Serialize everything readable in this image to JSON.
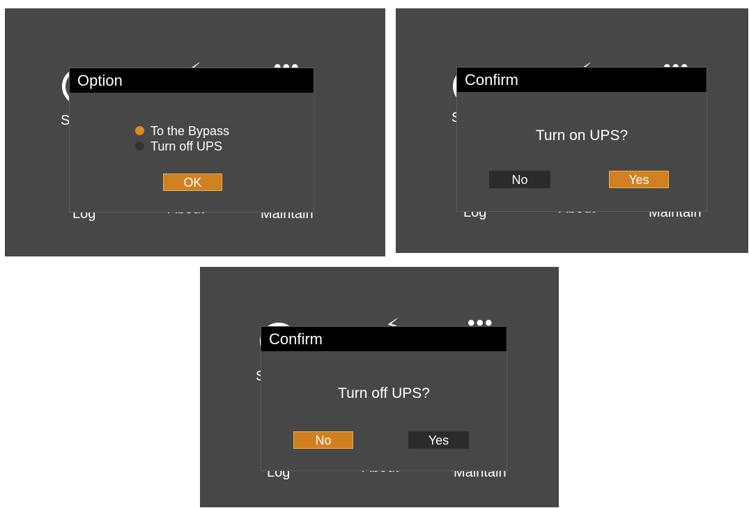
{
  "colors": {
    "screen_bg": "#474747",
    "title_bar": "#000000",
    "accent": "#d08020",
    "inactive_button": "#2b2b2b",
    "text": "#ffffff"
  },
  "background_menu": {
    "s_label": "S",
    "log_label": "Log",
    "about_label": "About",
    "maintain_label": "Maintain"
  },
  "panels": [
    {
      "title": "Option",
      "options": [
        {
          "label": "To the Bypass",
          "selected": true
        },
        {
          "label": "Turn off UPS",
          "selected": false
        }
      ],
      "ok_label": "OK"
    },
    {
      "title": "Confirm",
      "question": "Turn on UPS?",
      "no_label": "No",
      "yes_label": "Yes",
      "focused": "Yes"
    },
    {
      "title": "Confirm",
      "question": "Turn off UPS?",
      "no_label": "No",
      "yes_label": "Yes",
      "focused": "No"
    }
  ]
}
